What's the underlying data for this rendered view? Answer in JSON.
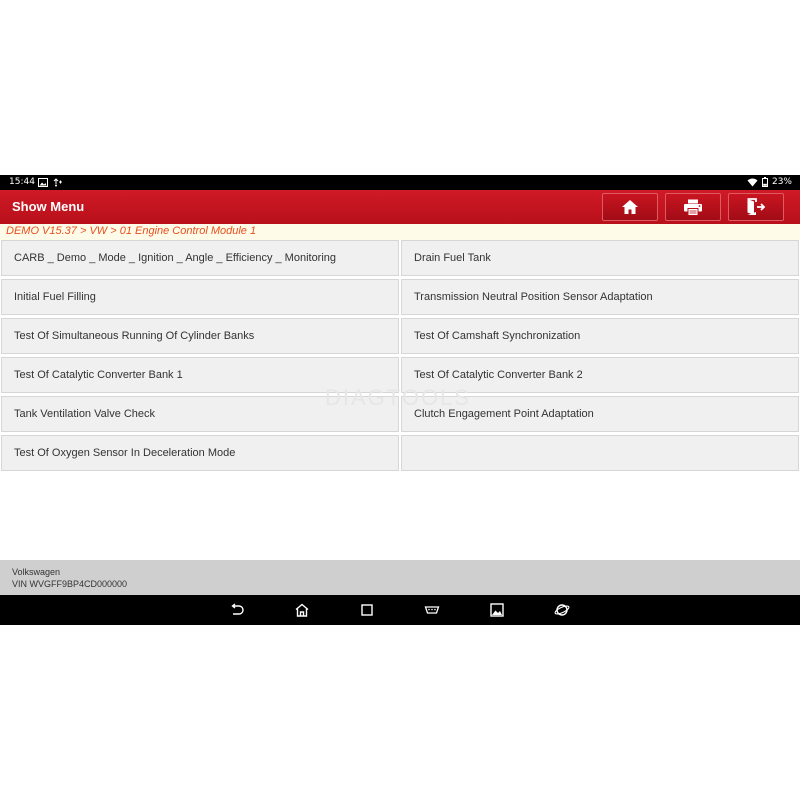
{
  "status_bar": {
    "time": "15:44",
    "battery": "23%"
  },
  "header": {
    "title": "Show Menu"
  },
  "breadcrumb": "DEMO V15.37 > VW > 01 Engine Control Module 1",
  "menu": {
    "items": [
      "CARB _ Demo _ Mode _ Ignition _ Angle _ Efficiency _ Monitoring",
      "Drain Fuel Tank",
      "Initial Fuel Filling",
      "Transmission Neutral Position Sensor Adaptation",
      "Test Of Simultaneous Running Of Cylinder Banks",
      "Test Of Camshaft Synchronization",
      "Test Of Catalytic Converter Bank 1",
      "Test Of Catalytic Converter Bank 2",
      "Tank Ventilation Valve Check",
      "Clutch Engagement Point Adaptation",
      "Test Of Oxygen Sensor In Deceleration Mode"
    ]
  },
  "watermark": "DIAGTOOLS",
  "vehicle": {
    "make": "Volkswagen",
    "vin": "VIN WVGFF9BP4CD000000"
  },
  "colors": {
    "header_red": "#c4121e",
    "breadcrumb_orange": "#e8501d",
    "cell_bg": "#f0f0f0"
  }
}
